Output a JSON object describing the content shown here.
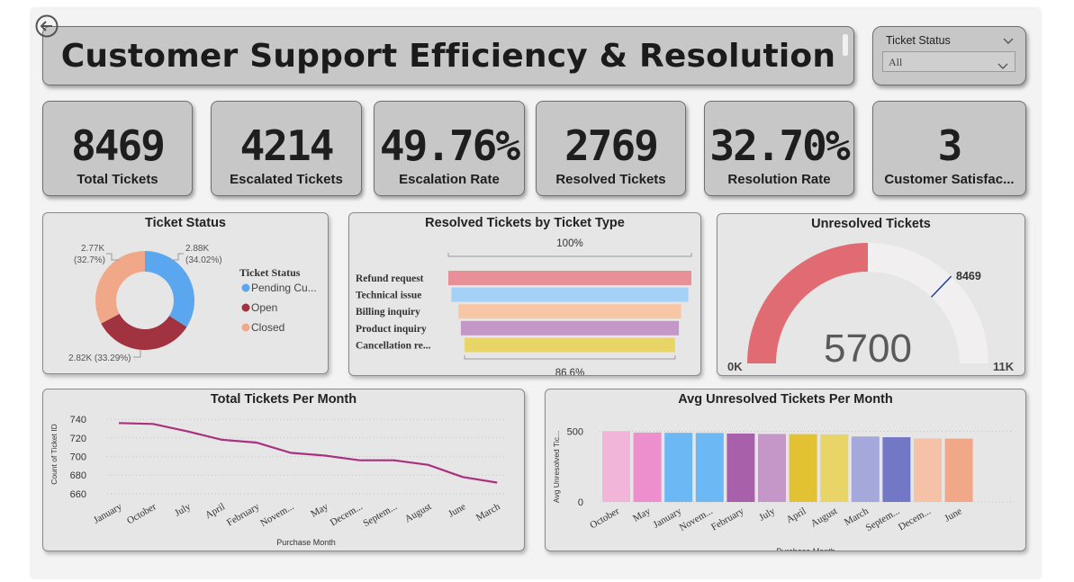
{
  "dashboard": {
    "title": "Customer Support Efficiency & Resolution",
    "filter": {
      "label": "Ticket Status",
      "value": "All"
    }
  },
  "kpis": [
    {
      "value": "8469",
      "label": "Total Tickets"
    },
    {
      "value": "4214",
      "label": "Escalated Tickets"
    },
    {
      "value": "49.76%",
      "label": "Escalation Rate"
    },
    {
      "value": "2769",
      "label": "Resolved Tickets"
    },
    {
      "value": "32.70%",
      "label": "Resolution Rate"
    },
    {
      "value": "3",
      "label": "Customer Satisfac..."
    }
  ],
  "icons": {
    "back": "back-arrow-icon",
    "dropdown": "chevron-down-icon"
  },
  "chart_data": [
    {
      "type": "pie",
      "title": "Ticket Status",
      "legend_title": "Ticket Status",
      "legend_position": "right",
      "slices": [
        {
          "label": "Pending Cu...",
          "value": 2880,
          "text": "2.88K",
          "pct": "(34.02%)",
          "color": "#5aa7f0"
        },
        {
          "label": "Open",
          "value": 2820,
          "text": "2.82K (33.29%)",
          "color": "#a1323f"
        },
        {
          "label": "Closed",
          "value": 2770,
          "text": "2.77K",
          "pct": "(32.7%)",
          "color": "#f0a889"
        }
      ]
    },
    {
      "type": "bar",
      "title": "Resolved Tickets by Ticket Type",
      "top_label": "100%",
      "bottom_label": "86.6%",
      "categories": [
        "Refund request",
        "Technical issue",
        "Billing inquiry",
        "Product inquiry",
        "Cancellation re..."
      ],
      "values": [
        100,
        97.5,
        91.6,
        89.7,
        86.6
      ],
      "colors": [
        "#e88f98",
        "#a6d1f7",
        "#f6c6a5",
        "#c597c9",
        "#e8d467"
      ]
    },
    {
      "type": "gauge",
      "title": "Unresolved Tickets",
      "value": 5700,
      "value_text": "5700",
      "min_text": "0K",
      "max_text": "11K",
      "min": 0,
      "max": 11400,
      "target": 8469,
      "target_text": "8469",
      "fill_color": "#e06b72",
      "target_color": "#1f3cad"
    },
    {
      "type": "line",
      "title": "Total Tickets Per Month",
      "xlabel": "Purchase Month",
      "ylabel": "Count of Ticket ID",
      "categories": [
        "January",
        "October",
        "July",
        "April",
        "February",
        "Novem...",
        "May",
        "Decem...",
        "Septem...",
        "August",
        "June",
        "March"
      ],
      "values": [
        736,
        735,
        727,
        718,
        715,
        704,
        701,
        696,
        696,
        691,
        678,
        672
      ],
      "yticks": [
        660,
        680,
        700,
        720,
        740
      ],
      "ylim": [
        657,
        745
      ],
      "color": "#a9317f",
      "grid": true
    },
    {
      "type": "bar",
      "title": "Avg Unresolved Tickets Per Month",
      "xlabel": "Purchase Month",
      "ylabel": "Avg Unresolved Tic...",
      "categories": [
        "October",
        "May",
        "January",
        "Novem...",
        "February",
        "July",
        "April",
        "August",
        "March",
        "Septem...",
        "Decem...",
        "June"
      ],
      "values": [
        502,
        492,
        490,
        489,
        485,
        482,
        481,
        479,
        464,
        459,
        450,
        449
      ],
      "yticks": [
        0,
        500
      ],
      "ylim": [
        0,
        560
      ],
      "colors": [
        "#f0b5d8",
        "#ee8fcd",
        "#6bb8f5",
        "#6bb8f5",
        "#a860aa",
        "#c597c9",
        "#e2c232",
        "#e8d467",
        "#a4a8da",
        "#7277c6",
        "#f5c2a8",
        "#f0a889"
      ],
      "grid": true
    }
  ]
}
